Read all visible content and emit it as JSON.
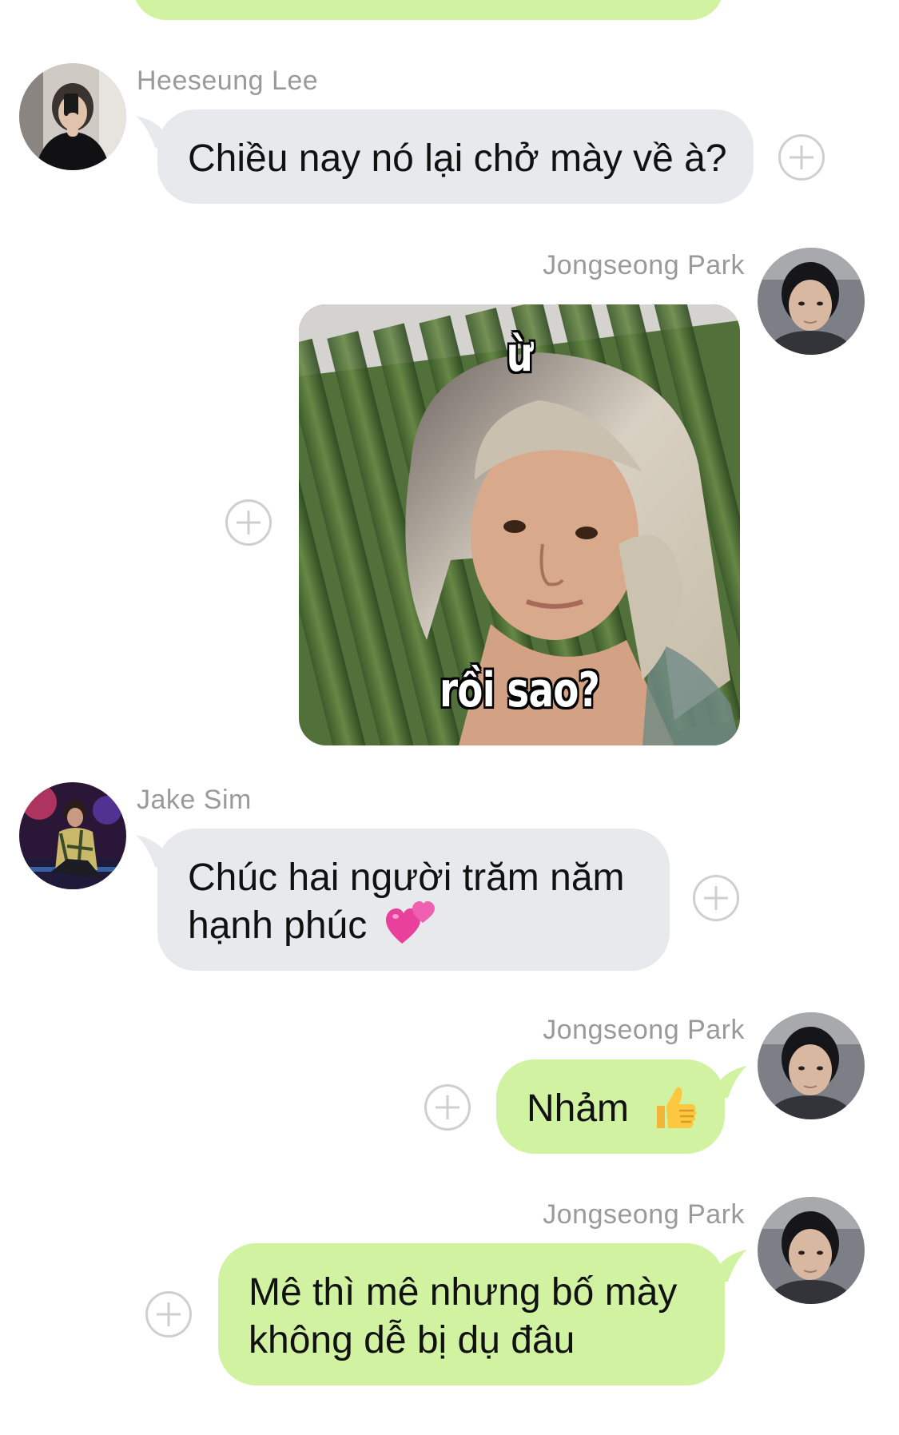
{
  "messages": [
    {
      "sender": "Heeseung Lee",
      "text": "Chiều nay nó lại chở mày về à?"
    },
    {
      "sender": "Jongseong Park",
      "sticker_top": "ừ",
      "sticker_bottom": "rồi sao?"
    },
    {
      "sender": "Jake Sim",
      "line1": "Chúc hai người trăm năm",
      "line2": "hạnh phúc",
      "emoji": "two-hearts-icon"
    },
    {
      "sender": "Jongseong Park",
      "text": "Nhảm",
      "emoji": "thumbs-up-icon"
    },
    {
      "sender": "Jongseong Park",
      "line1": "Mê thì mê nhưng bố mày",
      "line2": "không dễ bị dụ đâu"
    }
  ],
  "colors": {
    "incoming_bubble": "#e8e9ec",
    "outgoing_bubble": "#d1f3a1",
    "sender_name": "#9a9a9a",
    "plus_icon": "#cfcfd2"
  }
}
